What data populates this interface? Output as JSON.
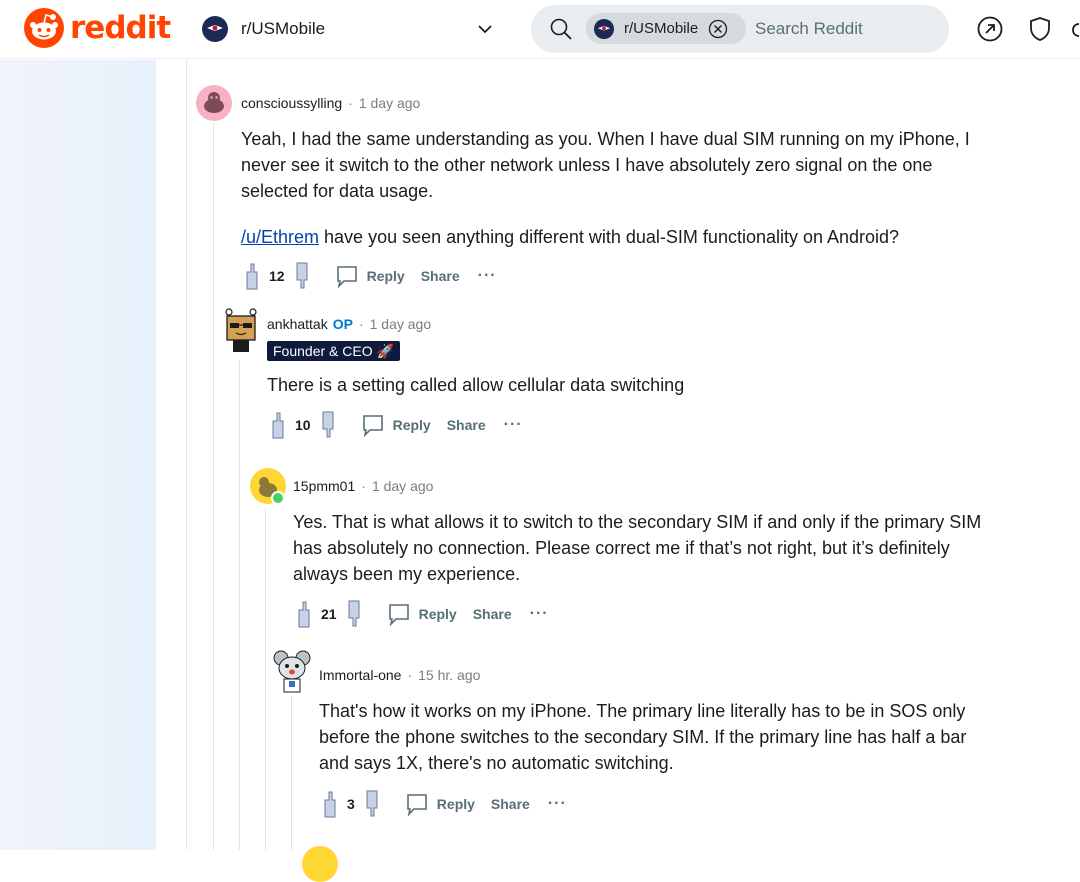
{
  "header": {
    "logo_text": "reddit",
    "community": "r/USMobile",
    "search_chip": "r/USMobile",
    "search_placeholder": "Search Reddit"
  },
  "comments": [
    {
      "author": "conscioussylling",
      "time": "1 day ago",
      "body_lines": [
        "Yeah, I had the same understanding as you. When I have dual SIM running on my iPhone, I",
        "never see it switch to the other network unless I have absolutely zero signal on the one",
        "selected for data usage."
      ],
      "link_text": "/u/Ethrem",
      "body_after_link": " have you seen anything different with dual-SIM functionality on Android?",
      "votes": "12",
      "reply": "Reply",
      "share": "Share",
      "more": "···"
    },
    {
      "author": "ankhattak",
      "op": "OP",
      "time": "1 day ago",
      "flair": "Founder & CEO 🚀",
      "body_lines": [
        "There is a setting called allow cellular data switching"
      ],
      "votes": "10",
      "reply": "Reply",
      "share": "Share",
      "more": "···"
    },
    {
      "author": "15pmm01",
      "time": "1 day ago",
      "body_lines": [
        "Yes. That is what allows it to switch to the secondary SIM if and only if the primary SIM",
        "has absolutely no connection. Please correct me if that’s not right, but it’s definitely",
        "always been my experience."
      ],
      "votes": "21",
      "reply": "Reply",
      "share": "Share",
      "more": "···"
    },
    {
      "author": "Immortal-one",
      "time": "15 hr. ago",
      "body_lines": [
        "That's how it works on my iPhone. The primary line literally has to be in SOS only",
        "before the phone switches to the secondary SIM. If the primary line has half a bar",
        "and says 1X, there's no automatic switching."
      ],
      "votes": "3",
      "reply": "Reply",
      "share": "Share",
      "more": "···"
    }
  ],
  "colors": {
    "brand": "#ff4500",
    "link": "#0045ac",
    "op": "#0079d3",
    "online": "#46d160"
  }
}
